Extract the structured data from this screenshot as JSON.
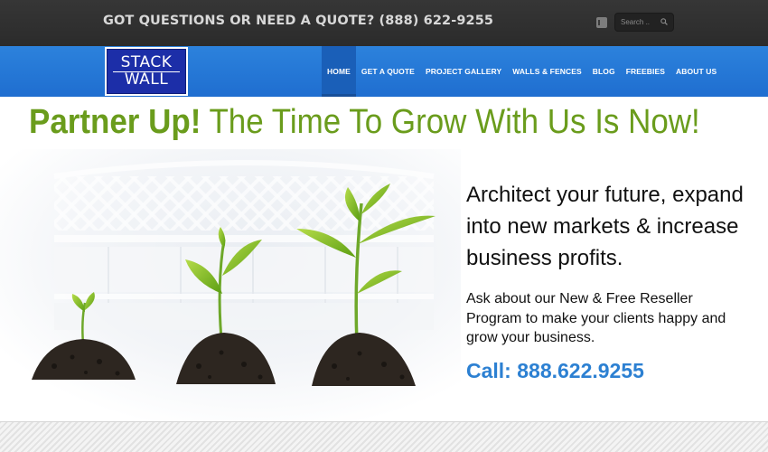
{
  "topbar": {
    "question": "GOT QUESTIONS OR NEED A QUOTE? (888) 622-9255",
    "search_placeholder": "Search ..",
    "social_icon": "feed-icon"
  },
  "logo": {
    "line1": "STACK",
    "line2": "WALL"
  },
  "nav": {
    "items": [
      {
        "label": "HOME",
        "active": true
      },
      {
        "label": "GET A QUOTE"
      },
      {
        "label": "PROJECT GALLERY"
      },
      {
        "label": "WALLS & FENCES"
      },
      {
        "label": "BLOG"
      },
      {
        "label": "FREEBIES"
      },
      {
        "label": "ABOUT US"
      }
    ]
  },
  "hero": {
    "headline_bold": "Partner Up!",
    "headline_rest": " The Time To Grow With Us Is Now!",
    "main_copy": "Architect your future, expand into new markets & increase business profits.",
    "sub_copy": "Ask about our New & Free Reseller Program to make your clients happy and grow your business.",
    "call": "Call: 888.622.9255"
  },
  "colors": {
    "topbar": "#2f2f2f",
    "navbar": "#2677d6",
    "headline_green": "#6a9c1c",
    "call_blue": "#2c80d2"
  }
}
